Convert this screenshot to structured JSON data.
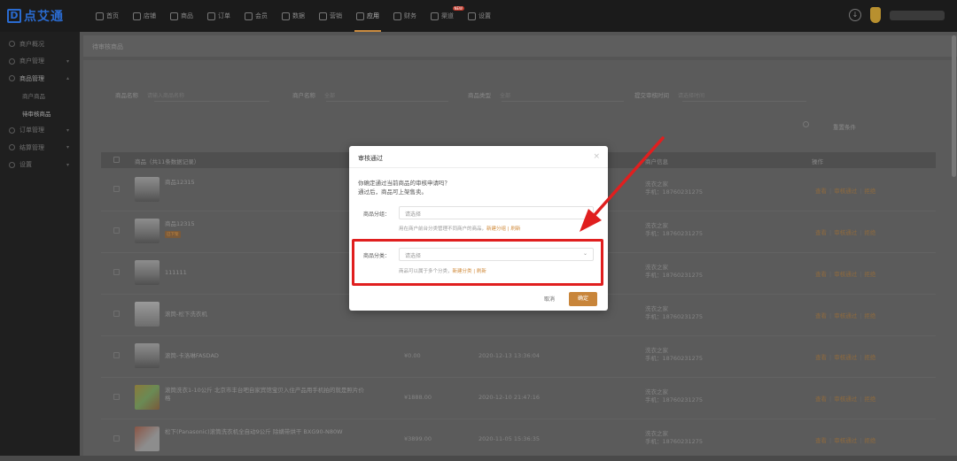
{
  "brand": {
    "name": "点艾通",
    "mark": "D"
  },
  "topnav": [
    {
      "label": "首页",
      "icon": "home-icon"
    },
    {
      "label": "店铺",
      "icon": "store-icon"
    },
    {
      "label": "商品",
      "icon": "goods-icon"
    },
    {
      "label": "订单",
      "icon": "order-icon"
    },
    {
      "label": "会员",
      "icon": "member-icon"
    },
    {
      "label": "数据",
      "icon": "data-icon"
    },
    {
      "label": "营销",
      "icon": "marketing-icon"
    },
    {
      "label": "应用",
      "icon": "app-icon",
      "active": true
    },
    {
      "label": "财务",
      "icon": "finance-icon"
    },
    {
      "label": "渠道",
      "icon": "channel-icon",
      "badge": "NEW"
    },
    {
      "label": "设置",
      "icon": "settings-icon"
    }
  ],
  "sidebar": {
    "items": [
      {
        "label": "商户概况"
      },
      {
        "label": "商户管理",
        "caret": "▾"
      },
      {
        "label": "商品管理",
        "caret": "▴",
        "open": true
      },
      {
        "label": "订单管理",
        "caret": "▾"
      },
      {
        "label": "结算管理",
        "caret": "▾"
      },
      {
        "label": "设置",
        "caret": "▾"
      }
    ],
    "subitems": [
      {
        "label": "商户商品"
      },
      {
        "label": "待审核商品",
        "active": true
      }
    ]
  },
  "breadcrumb": "待审核商品",
  "filters": {
    "name_label": "商品名称",
    "name_placeholder": "请输入商品名称",
    "merchant_label": "商户名称",
    "merchant_value": "全部",
    "type_label": "商品类型",
    "type_value": "全部",
    "time_label": "提交审核时间",
    "time_placeholder": "请选择时间",
    "reset_label": "重置条件"
  },
  "table": {
    "headers": {
      "goods": "商品（共11条数据记录）",
      "merchant": "商户信息",
      "ops": "操作"
    },
    "ops": [
      "查看",
      "审核通过",
      "拒绝"
    ],
    "rows": [
      {
        "name": "商品12315",
        "price": "",
        "time": "",
        "merchant": "洗衣之家",
        "phone": "手机：18760231275"
      },
      {
        "name": "商品12315",
        "tag": "已下架",
        "price": "",
        "time": "",
        "merchant": "洗衣之家",
        "phone": "手机：18760231275"
      },
      {
        "name": "111111",
        "price": "",
        "time": "",
        "merchant": "洗衣之家",
        "phone": "手机：18760231275"
      },
      {
        "name": "滚筒-松下洗衣机",
        "price": "",
        "time": "",
        "merchant": "洗衣之家",
        "phone": "手机：18760231275"
      },
      {
        "name": "滚筒-卡洛琳FASDAD",
        "price": "¥0.00",
        "time": "2020-12-13 13:36:04",
        "merchant": "洗衣之家",
        "phone": "手机：18760231275"
      },
      {
        "name": "滚筒洗衣1-10公斤 北京市丰台吧自家宾馆宝贝入住产品用手机拍的就是照片价格",
        "price": "¥1888.00",
        "time": "2020-12-10 21:47:16",
        "merchant": "洗衣之家",
        "phone": "手机：18760231275"
      },
      {
        "name": "松下(Panasonic)滚筒洗衣机全自动9公斤 除螨带烘干 BXG90-N80W",
        "price": "¥3899.00",
        "time": "2020-11-05 15:36:35",
        "merchant": "洗衣之家",
        "phone": "手机：18760231275"
      }
    ]
  },
  "dialog": {
    "title": "审核通过",
    "close": "×",
    "message1": "你确定通过当前商品的审核申请吗？",
    "message2": "通过后，商品可上架售卖。",
    "field1_label": "商品分组：",
    "field1_placeholder": "请选择",
    "field1_hint": "用在商户前台分类管理不同商户的商品，",
    "field1_link1": "新建分组",
    "field1_link2": "刷新",
    "field2_label": "商品分类：",
    "field2_placeholder": "请选择",
    "field2_hint": "商品可以属于多个分类，",
    "field2_link1": "新建分类",
    "field2_link2": "刷新",
    "cancel": "取消",
    "ok": "确定"
  },
  "colors": {
    "accent": "#c8853a",
    "highlight": "#e01f1f",
    "brand": "#2a6bd0"
  }
}
